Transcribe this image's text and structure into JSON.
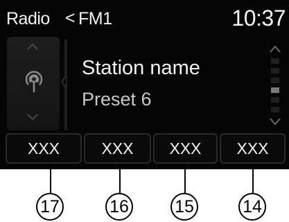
{
  "header": {
    "source": "Radio",
    "separator": "<",
    "band": "FM1",
    "clock": "10:37"
  },
  "side_panel": {
    "up_icon": "chevron-up-icon",
    "down_icon": "chevron-down-icon",
    "source_icon": "radio-broadcast-icon"
  },
  "station": {
    "name": "Station name",
    "preset": "Preset 6"
  },
  "scrollbar": {
    "up_icon": "chevron-up-icon",
    "down_icon": "chevron-down-icon",
    "position_fraction": 0.7
  },
  "soft_keys": [
    {
      "label": "XXX"
    },
    {
      "label": "XXX"
    },
    {
      "label": "XXX"
    },
    {
      "label": "XXX"
    }
  ],
  "callouts": [
    "17",
    "16",
    "15",
    "14"
  ],
  "colors": {
    "screen_bg": "#050505",
    "text": "#f2f2f2",
    "secondary_text": "#c8c8c8"
  }
}
